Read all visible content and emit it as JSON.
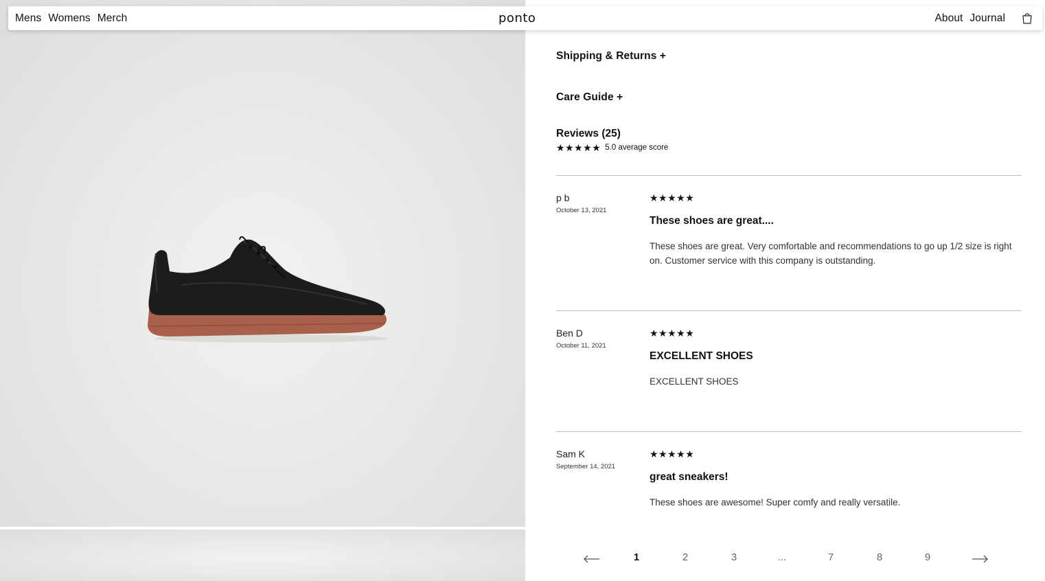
{
  "nav": {
    "left": [
      "Mens",
      "Womens",
      "Merch"
    ],
    "logo": "ponto",
    "right": [
      "About",
      "Journal"
    ],
    "cart_icon": "shopping-bag-icon"
  },
  "accordions": {
    "shipping": "Shipping & Returns +",
    "care": "Care Guide +"
  },
  "reviews": {
    "title": "Reviews (25)",
    "stars": "★★★★★",
    "average": "5.0 average score",
    "items": [
      {
        "author": "p b",
        "date": "October 13, 2021",
        "stars": "★★★★★",
        "title": "These shoes are great....",
        "body": "These shoes are great. Very comfortable and recommendations to go up 1/2 size is right on. Customer service with this company is outstanding."
      },
      {
        "author": "Ben D",
        "date": "October 11, 2021",
        "stars": "★★★★★",
        "title": "EXCELLENT SHOES",
        "body": "EXCELLENT SHOES"
      },
      {
        "author": "Sam K",
        "date": "September 14, 2021",
        "stars": "★★★★★",
        "title": "great sneakers!",
        "body": "These shoes are awesome! Super comfy and really versatile."
      }
    ]
  },
  "pagination": {
    "prev_icon": "arrow-left-icon",
    "next_icon": "arrow-right-icon",
    "pages": [
      "1",
      "2",
      "3",
      "...",
      "7",
      "8",
      "9"
    ],
    "current": "1"
  },
  "colors": {
    "sole": "#a8604a",
    "upper": "#1c1c1c",
    "divider": "#bdbdbd"
  }
}
